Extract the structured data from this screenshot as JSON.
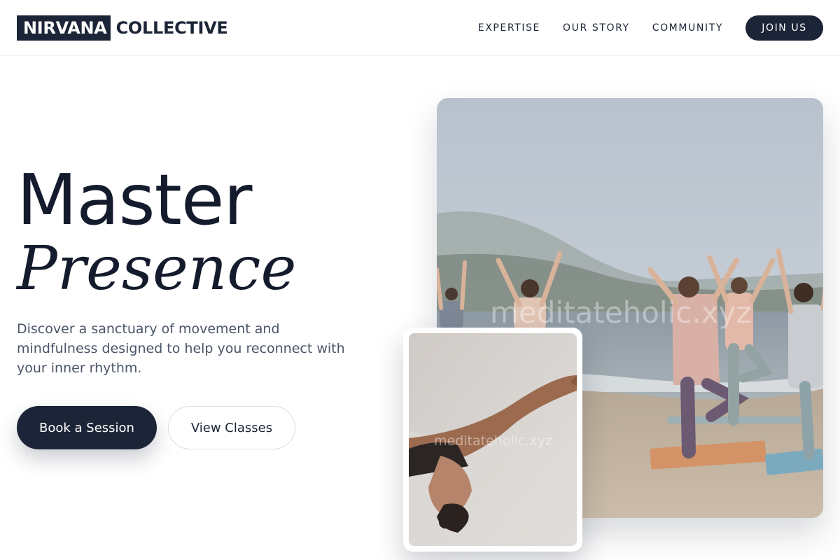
{
  "brand": {
    "box_text": "NIRVANA",
    "word_text": "COLLECTIVE"
  },
  "nav": {
    "links": [
      "EXPERTISE",
      "OUR STORY",
      "COMMUNITY"
    ],
    "cta": "JOIN US"
  },
  "hero": {
    "title_line1": "Master",
    "title_line2": "Presence",
    "description": "Discover a sanctuary of movement and mindfulness designed to help you reconnect with your inner rhythm.",
    "primary_button": "Book a Session",
    "secondary_button": "View Classes"
  },
  "images": {
    "main_alt": "Group of people practicing yoga on a beach",
    "inset_alt": "Woman in a yoga backbend pose",
    "watermark": "meditateholic.xyz"
  },
  "colors": {
    "primary": "#1c2537",
    "text_muted": "#4a5568",
    "background": "#ffffff"
  },
  "icons": []
}
